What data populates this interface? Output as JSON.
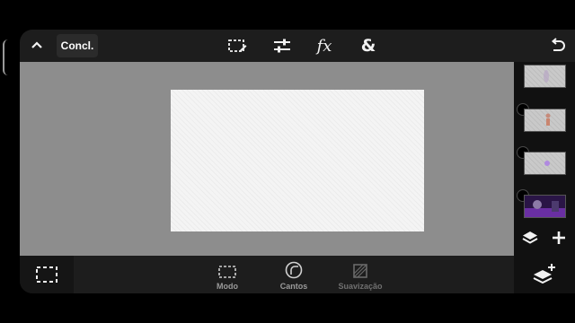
{
  "toolbar": {
    "collapse_icon": "chevron-up-icon",
    "done_label": "Concl.",
    "tools": [
      {
        "name": "select-tool",
        "icon": "dashed-selection-edit-icon"
      },
      {
        "name": "adjust-tool",
        "icon": "sliders-icon"
      },
      {
        "name": "effects-tool",
        "label": "fx"
      },
      {
        "name": "blend-tool",
        "label": "&"
      }
    ],
    "undo_icon": "undo-icon"
  },
  "canvas": {
    "background_color": "#8d8d8d",
    "image_color": "#f4f4f4",
    "transparent": true
  },
  "layers_panel": {
    "layers": [
      {
        "name": "layer-1",
        "thumbnail": "checkerboard-pale-figure"
      },
      {
        "name": "layer-2",
        "thumbnail": "checkerboard-pink-figure"
      },
      {
        "name": "layer-3",
        "thumbnail": "checkerboard-purple-dot"
      },
      {
        "name": "layer-4",
        "thumbnail": "purple-scene"
      }
    ],
    "layers_icon": "layers-icon",
    "add_icon": "plus-icon",
    "add_layer_icon": "add-layer-icon"
  },
  "bottombar": {
    "selection_icon": "dashed-rectangle-icon",
    "items": [
      {
        "label": "Modo",
        "icon": "dashed-rectangle-icon",
        "enabled": true
      },
      {
        "label": "Cantos",
        "icon": "rounded-corner-icon",
        "enabled": true
      },
      {
        "label": "Suavização",
        "icon": "feather-square-icon",
        "enabled": false
      }
    ]
  }
}
